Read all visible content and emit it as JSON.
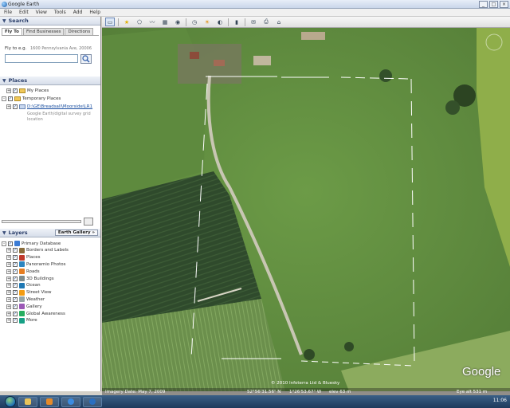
{
  "window": {
    "title": "Google Earth",
    "controls": [
      "_",
      "□",
      "×"
    ]
  },
  "menu": [
    "File",
    "Edit",
    "View",
    "Tools",
    "Add",
    "Help"
  ],
  "search": {
    "header": "Search",
    "tabs": [
      "Fly To",
      "Find Businesses",
      "Directions"
    ],
    "fly_label": "Fly to e.g.",
    "fly_hint": "1600 Pennsylvania Ave, 20006",
    "input_value": ""
  },
  "places": {
    "header": "Places",
    "items": [
      {
        "label": "My Places"
      },
      {
        "label": "Temporary Places"
      },
      {
        "label": "D:\\GE\\Breadsall\\Moorside\\LR1"
      }
    ],
    "description": "Google Earth/digital survey grid location"
  },
  "layers": {
    "header": "Layers",
    "gallery_button": "Earth Gallery »",
    "items": [
      {
        "label": "Primary Database",
        "color": "#3a7bd5"
      },
      {
        "label": "Borders and Labels",
        "color": "#8a6d3b"
      },
      {
        "label": "Places",
        "color": "#c0392b"
      },
      {
        "label": "Panoramio Photos",
        "color": "#2e86c1"
      },
      {
        "label": "Roads",
        "color": "#e67e22"
      },
      {
        "label": "3D Buildings",
        "color": "#7f8c8d"
      },
      {
        "label": "Ocean",
        "color": "#1f78b4"
      },
      {
        "label": "Street View",
        "color": "#f39c12"
      },
      {
        "label": "Weather",
        "color": "#95a5a6"
      },
      {
        "label": "Gallery",
        "color": "#9b59b6"
      },
      {
        "label": "Global Awareness",
        "color": "#27ae60"
      },
      {
        "label": "More",
        "color": "#16a085"
      }
    ]
  },
  "status": {
    "imagery_date": "Imagery Date: May 7, 2009",
    "lat": "52°56'31.56\" N",
    "lon": "1°26'53.67\" W",
    "elev": "elev  63 m",
    "eye_alt": "Eye alt  531 m",
    "copyright": "© 2010 Infoterra Ltd & Bluesky",
    "logo": "Google"
  },
  "taskbar": {
    "clock": "11:06"
  }
}
